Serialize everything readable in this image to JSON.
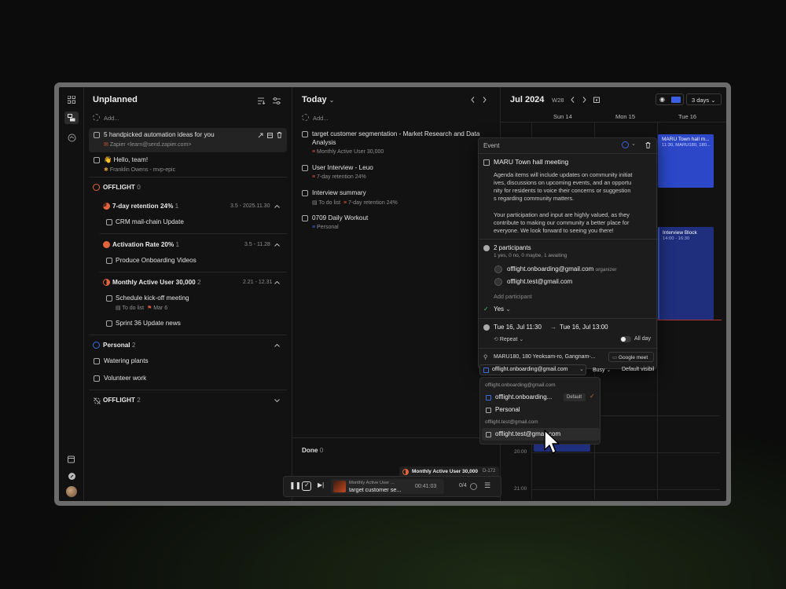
{
  "unplanned": {
    "title": "Unplanned",
    "add_placeholder": "Add...",
    "tasks": [
      {
        "title": "5 handpicked automation ideas for you",
        "sub": "Zapier <learn@send.zapier.com>"
      },
      {
        "title": "👋 Hello, team!",
        "sub": "Franklin Owens - mvp-epic"
      }
    ],
    "groups": {
      "offlight1": {
        "name": "OFFLIGHT",
        "count": "0"
      },
      "retention": {
        "name": "7-day retention 24%",
        "count": "1",
        "range": "3.5 - 2025.11.30",
        "task": "CRM mail-chain Update"
      },
      "activation": {
        "name": "Activation Rate 20%",
        "count": "1",
        "range": "3.5 - 11.28",
        "task": "Produce Onboarding Videos"
      },
      "mau": {
        "name": "Monthly Active User 30,000",
        "count": "2",
        "range": "2.21 - 12.31",
        "task1": "Schedule kick-off meeting",
        "task1_list": "To do list",
        "task1_date": "Mar 6",
        "task2": "Sprint 36 Update news"
      },
      "personal": {
        "name": "Personal",
        "count": "2",
        "task1": "Watering plants",
        "task2": "Volunteer work"
      },
      "offlight2": {
        "name": "OFFLIGHT",
        "count": "2"
      }
    }
  },
  "today": {
    "title": "Today",
    "add_placeholder": "Add...",
    "tasks": [
      {
        "title_line1": "target customer segmentation - Market Research and Data",
        "title_line2": "Analysis",
        "sub": "Monthly Active User 30,000"
      },
      {
        "title_line1": "User Interview - Leuo",
        "sub": "7-day retention 24%"
      },
      {
        "title_line1": "Interview summary",
        "sub_list": "To do list",
        "sub": "7-day retention 24%"
      },
      {
        "title_line1": "0709 Daily Workout",
        "sub": "Personal"
      }
    ],
    "done_label": "Done",
    "done_count": "0"
  },
  "player": {
    "badge": "Monthly Active User 30,000",
    "badge_tag": "D-172",
    "track_sub": "Monthly Active User ...",
    "track_title": "target customer se...",
    "time": "00:41:03",
    "progress": "0/4"
  },
  "calendar": {
    "month": "Jul 2024",
    "week": "W28",
    "view": "3 days",
    "days": [
      "Sun 14",
      "Mon 15",
      "Tue 16"
    ],
    "hours": [
      "20:00",
      "21:00"
    ],
    "events": [
      {
        "title": "MARU Town hall m...",
        "time": "11:30, MARU180, 180..."
      },
      {
        "title": "Interview Block",
        "time": "14:00 - 16:30"
      }
    ],
    "colors": {
      "event": "#2c48c9",
      "event_dark": "#1f2f7d",
      "now_line": "#b23333"
    }
  },
  "event_popup": {
    "header": "Event",
    "title": "MARU Town hall meeting",
    "desc_lines": [
      "Agenda items will include updates on community initiat",
      "ives, discussions on upcoming events, and an opportu",
      "nity for residents to voice their concerns or suggestion",
      "s regarding community matters."
    ],
    "desc2_lines": [
      "Your participation and input are highly valued, as they",
      "contribute to making our community a better place for",
      "everyone. We look forward to seeing you there!"
    ],
    "participants_title": "2 participants",
    "participants_summary": "1 yes, 0 no, 0 maybe, 1 awaiting",
    "participant1": "offlight.onboarding@gmail.com",
    "participant1_role": "organizer",
    "participant2": "offlight.test@gmail.com",
    "add_participant": "Add participant",
    "rsvp": "Yes",
    "start": "Tue 16, Jul  11:30",
    "end": "Tue 16, Jul  13:00",
    "repeat": "Repeat",
    "all_day": "All day",
    "location": "MARU180, 180 Yeoksam-ro, Gangnam-...",
    "meet": "Google meet",
    "calendar_select": "offlight.onboarding@gmail.com",
    "busy": "Busy",
    "visibility": "Default visibil"
  },
  "calendar_dropdown": {
    "section1": "offlight.onboarding@gmail.com",
    "item1": "offlight.onboarding...",
    "item1_badge": "Default",
    "item2": "Personal",
    "section2": "offlight.test@gmail.com",
    "item3": "offlight.test@gmail.com"
  }
}
